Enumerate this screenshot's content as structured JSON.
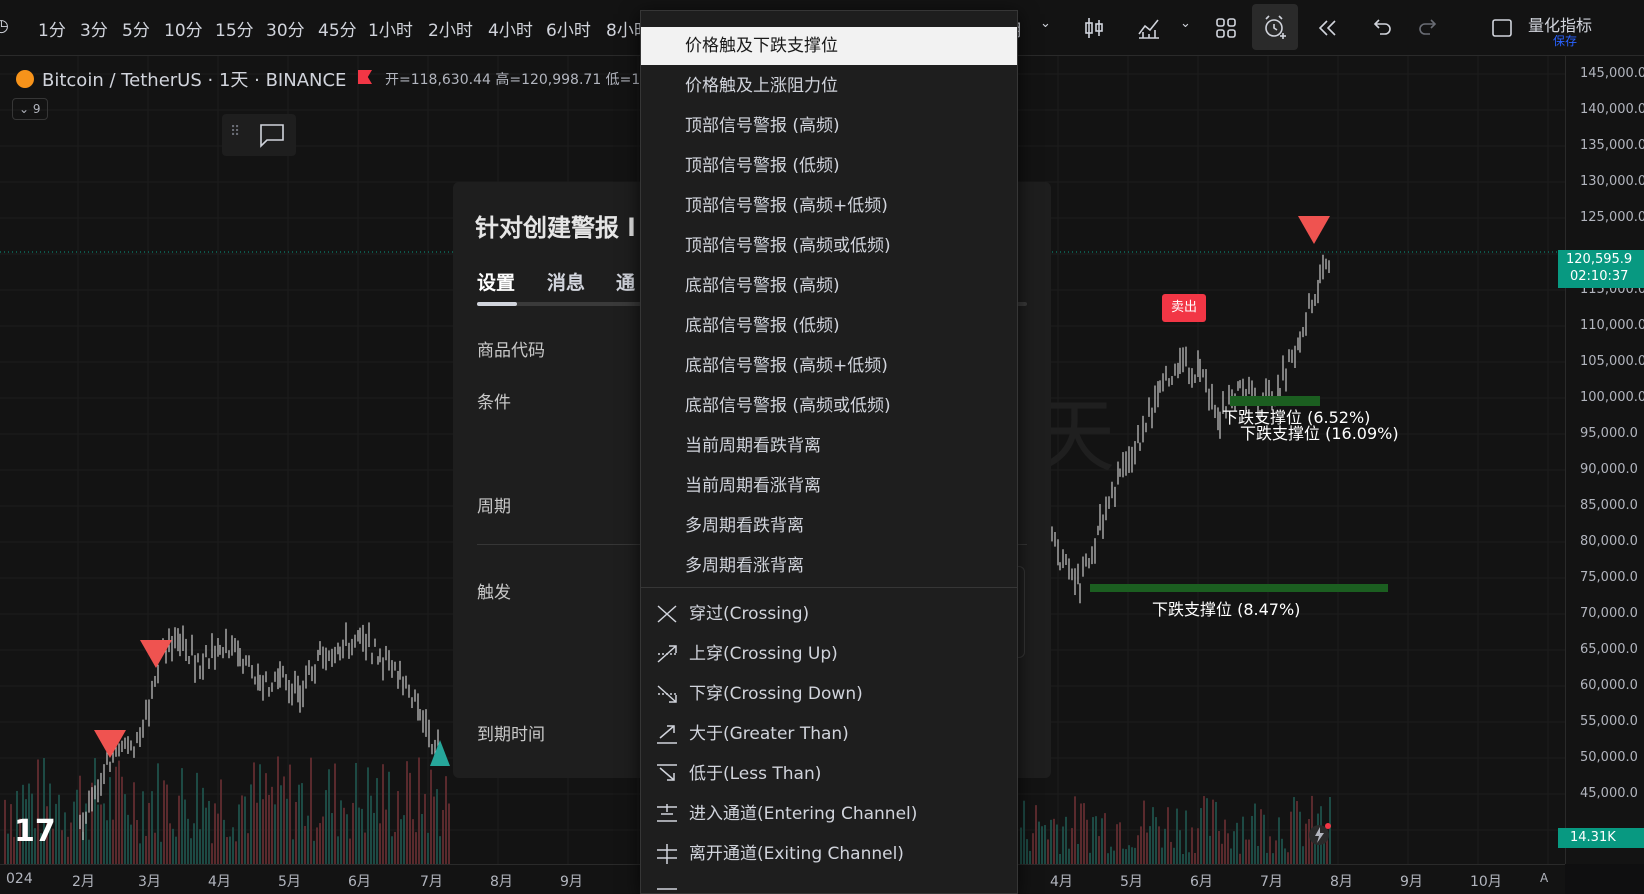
{
  "toolbar": {
    "intervals": [
      "1分",
      "3分",
      "5分",
      "10分",
      "15分",
      "30分",
      "45分",
      "1小时",
      "2小时",
      "4小时",
      "6小时",
      "8小时"
    ],
    "right_month": "月",
    "quant_label": "量化指标",
    "save_label": "保存"
  },
  "symbol": {
    "name": "Bitcoin / TetherUS · 1天 · BINANCE",
    "ohlc": "开=118,630.44 高=120,998.71 低=1",
    "indicator_count": "9"
  },
  "dialog": {
    "title": "针对创建警报 l",
    "tabs": [
      "设置",
      "消息",
      "通"
    ],
    "fields": [
      "商品代码",
      "条件",
      "周期",
      "触发",
      "到期时间"
    ]
  },
  "dropdown": {
    "items": [
      "价格触及下跌支撑位",
      "价格触及上涨阻力位",
      "顶部信号警报 (高频)",
      "顶部信号警报 (低频)",
      "顶部信号警报 (高频+低频)",
      "顶部信号警报 (高频或低频)",
      "底部信号警报 (高频)",
      "底部信号警报 (低频)",
      "底部信号警报 (高频+低频)",
      "底部信号警报 (高频或低频)",
      "当前周期看跌背离",
      "当前周期看涨背离",
      "多周期看跌背离",
      "多周期看涨背离"
    ],
    "selected_index": 0,
    "conditions": [
      {
        "label": "穿过(Crossing)",
        "icon": "crossing-icon"
      },
      {
        "label": "上穿(Crossing Up)",
        "icon": "crossing-up-icon"
      },
      {
        "label": "下穿(Crossing Down)",
        "icon": "crossing-down-icon"
      },
      {
        "label": "大于(Greater Than)",
        "icon": "greater-than-icon"
      },
      {
        "label": "低于(Less Than)",
        "icon": "less-than-icon"
      },
      {
        "label": "进入通道(Entering Channel)",
        "icon": "entering-channel-icon"
      },
      {
        "label": "离开通道(Exiting Channel)",
        "icon": "exiting-channel-icon"
      }
    ]
  },
  "chart_labels": {
    "sell": "卖出",
    "support1": "下跌支撑位 (6.52%)",
    "support2": "下跌支撑位 (16.09%)",
    "support3": "下跌支撑位 (8.47%)",
    "watermark": "天"
  },
  "price_axis": {
    "labels": [
      "145,000.0",
      "140,000.0",
      "135,000.0",
      "130,000.0",
      "125,000.0",
      "115,000.0",
      "110,000.0",
      "105,000.0",
      "100,000.0",
      "95,000.0",
      "90,000.0",
      "85,000.0",
      "80,000.0",
      "75,000.0",
      "70,000.0",
      "65,000.0",
      "60,000.0",
      "55,000.0",
      "50,000.0",
      "45,000.0"
    ],
    "current_price": "120,595.9",
    "countdown": "02:10:37",
    "volume": "14.31K"
  },
  "time_axis": {
    "labels": [
      "024",
      "2月",
      "3月",
      "4月",
      "5月",
      "6月",
      "7月",
      "8月",
      "9月",
      "4月",
      "5月",
      "6月",
      "7月",
      "8月",
      "9月",
      "10月"
    ],
    "corner": "A"
  },
  "colors": {
    "up": "#26a69a",
    "down": "#ef5350",
    "support_band": "#1b5e20",
    "current_price_bg": "#089981",
    "accent_red": "#f23645"
  }
}
